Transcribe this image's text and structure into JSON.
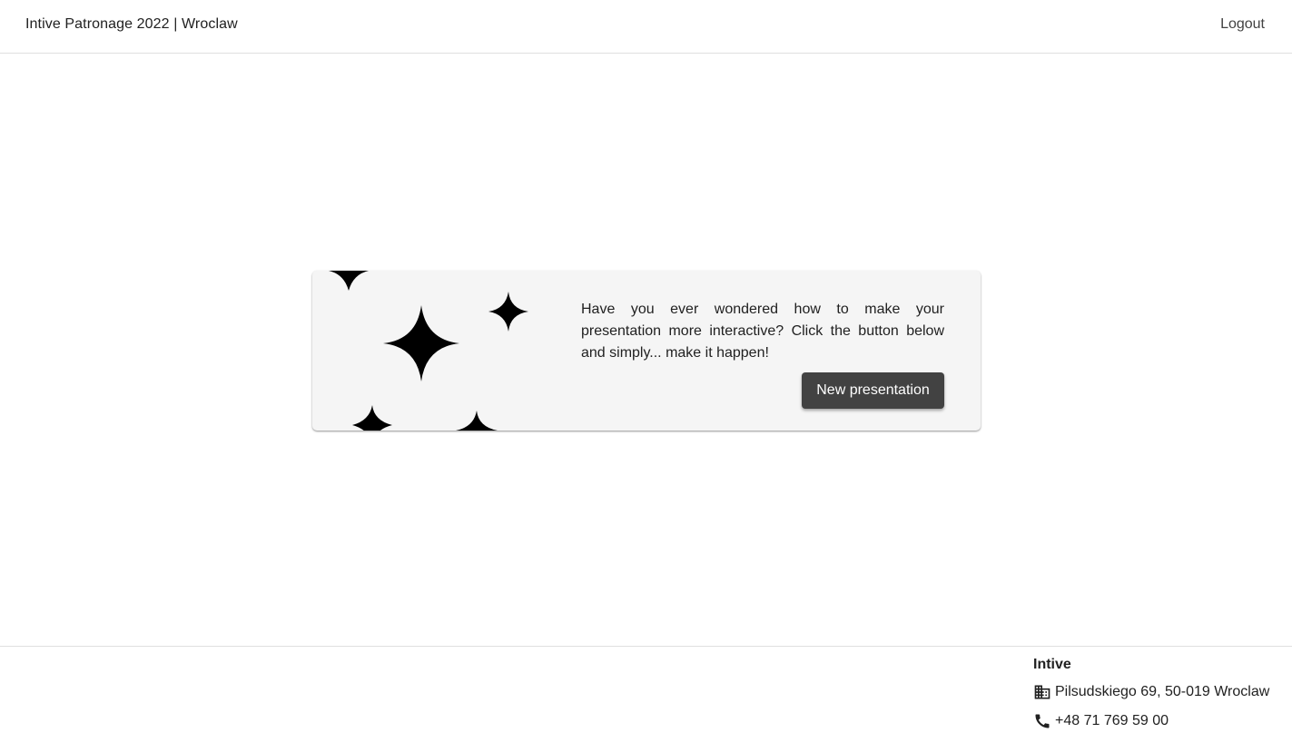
{
  "header": {
    "title": "Intive Patronage 2022 | Wroclaw",
    "logout_label": "Logout"
  },
  "card": {
    "text": "Have you ever wondered how to make your presentation more interactive? Click the button below and simply... make it happen!",
    "button_label": "New presentation",
    "decoration_icon": "sparkles-icon"
  },
  "footer": {
    "company": "Intive",
    "address": "Pilsudskiego 69, 50-019 Wroclaw",
    "address_icon": "building-icon",
    "phone": "+48 71 769 59 00",
    "phone_icon": "phone-icon"
  },
  "colors": {
    "button_bg": "#424242",
    "card_bg": "#f5f5f5"
  }
}
